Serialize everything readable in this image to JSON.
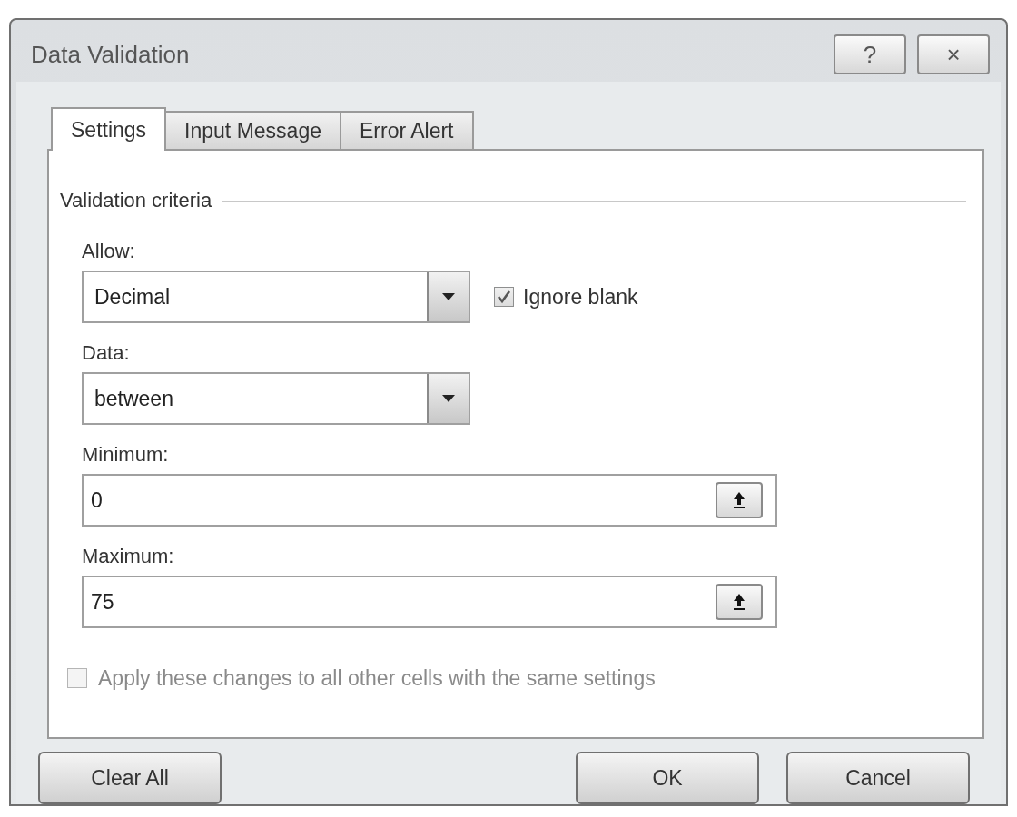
{
  "window": {
    "title": "Data Validation",
    "title_buttons": [
      "?",
      "×"
    ]
  },
  "tabs": [
    {
      "label": "Settings",
      "selected": true
    },
    {
      "label": "Input Message",
      "selected": false
    },
    {
      "label": "Error Alert",
      "selected": false
    }
  ],
  "settings": {
    "group_title": "Validation criteria",
    "allow": {
      "label": "Allow:",
      "value": "Decimal"
    },
    "ignore_blank": {
      "label": "Ignore blank",
      "checked": true
    },
    "data": {
      "label": "Data:",
      "value": "between"
    },
    "minimum": {
      "label": "Minimum:",
      "value": "0"
    },
    "maximum": {
      "label": "Maximum:",
      "value": "75"
    },
    "apply_all": {
      "label": "Apply these changes to all other cells with the same settings",
      "checked": false,
      "disabled": true
    }
  },
  "buttons": [
    {
      "label": "Clear All"
    },
    {
      "label": "OK"
    },
    {
      "label": "Cancel"
    }
  ]
}
